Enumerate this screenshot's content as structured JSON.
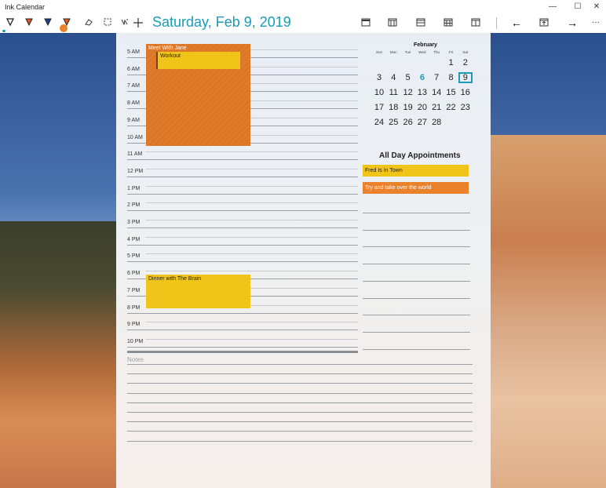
{
  "app": {
    "title": "Ink Calendar",
    "window_controls": {
      "minimize": "—",
      "maximize": "☐",
      "close": "✕"
    }
  },
  "toolbar": {
    "date_title": "Saturday, Feb 9, 2019",
    "tools": [
      {
        "name": "ballpoint-pen-icon",
        "color": "#222222"
      },
      {
        "name": "pencil-icon",
        "color": "#e05a1e"
      },
      {
        "name": "highlighter-icon",
        "color": "#1f3f8f"
      },
      {
        "name": "pen-icon",
        "color": "#e05a1e"
      },
      {
        "name": "eraser-icon",
        "color": "#333333"
      },
      {
        "name": "lasso-select-icon",
        "color": "#333333"
      },
      {
        "name": "ink-to-text-icon",
        "color": "#333333"
      },
      {
        "name": "add-icon",
        "color": "#333333"
      }
    ],
    "view_buttons": [
      "day-view-icon",
      "week-view-icon",
      "month-view-icon",
      "year-view-icon",
      "agenda-view-icon"
    ],
    "nav": {
      "back": "←",
      "today": "today-icon",
      "forward": "→",
      "more": "···"
    }
  },
  "day": {
    "hours": [
      "5 AM",
      "6 AM",
      "7 AM",
      "8 AM",
      "9 AM",
      "10 AM",
      "11 AM",
      "12 PM",
      "1 PM",
      "2 PM",
      "3 PM",
      "4 PM",
      "5 PM",
      "6 PM",
      "7 PM",
      "8 PM",
      "9 PM",
      "10 PM"
    ],
    "events": {
      "jane": "Meet With Jane",
      "workout": "Workout",
      "brain": "Dinner with The Brain"
    },
    "notes_label": "Notes"
  },
  "calendar": {
    "month": "February",
    "weekdays": [
      "Sun",
      "Mon",
      "Tue",
      "Wed",
      "Thu",
      "Fri",
      "Sat"
    ],
    "weeks": [
      [
        "",
        "",
        "",
        "",
        "",
        "1",
        "2"
      ],
      [
        "3",
        "4",
        "5",
        "6",
        "7",
        "8",
        "9"
      ],
      [
        "10",
        "11",
        "12",
        "13",
        "14",
        "15",
        "16"
      ],
      [
        "17",
        "18",
        "19",
        "20",
        "21",
        "22",
        "23"
      ],
      [
        "24",
        "25",
        "26",
        "27",
        "28",
        "",
        ""
      ]
    ],
    "today": "6",
    "selected": "9"
  },
  "all_day": {
    "title": "All Day Appointments",
    "items": [
      "Fred Is In Town",
      "Try and take over the world"
    ]
  },
  "colors": {
    "accent": "#1a9bb6",
    "orange_event": "#e07b2a",
    "yellow_event": "#f0c419"
  }
}
